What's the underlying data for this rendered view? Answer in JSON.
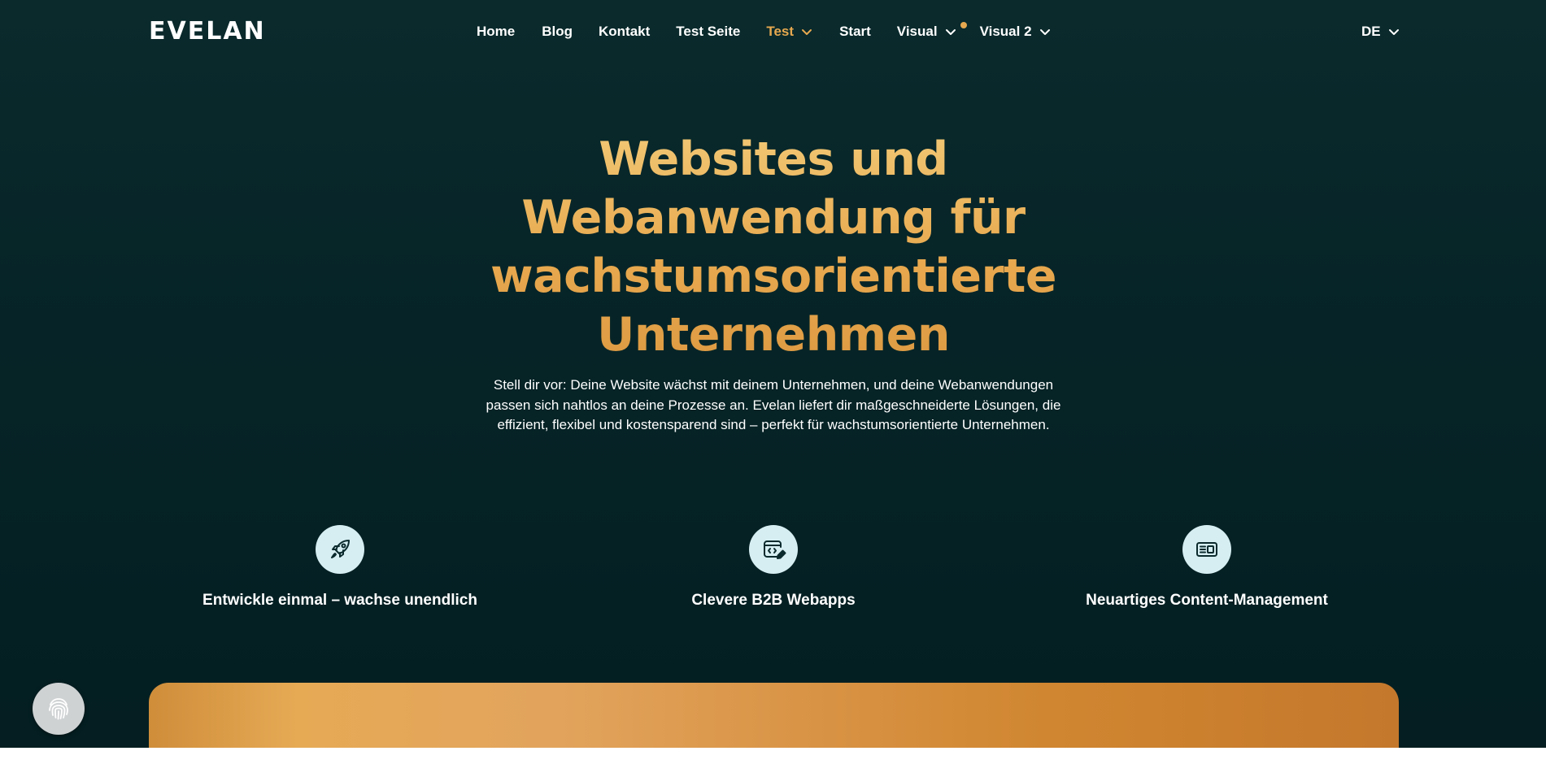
{
  "brand": {
    "logo_text": "EVELAN"
  },
  "nav": {
    "items": [
      {
        "label": "Home",
        "has_dropdown": false,
        "active": false
      },
      {
        "label": "Blog",
        "has_dropdown": false,
        "active": false
      },
      {
        "label": "Kontakt",
        "has_dropdown": false,
        "active": false
      },
      {
        "label": "Test Seite",
        "has_dropdown": false,
        "active": false
      },
      {
        "label": "Test",
        "has_dropdown": true,
        "active": true
      },
      {
        "label": "Start",
        "has_dropdown": false,
        "active": false
      },
      {
        "label": "Visual",
        "has_dropdown": true,
        "active": false,
        "notification_dot": true
      },
      {
        "label": "Visual 2",
        "has_dropdown": true,
        "active": false
      }
    ],
    "language": "DE"
  },
  "hero": {
    "headline_lines": [
      "Websites und",
      "Webanwendung für",
      "wachstumsorientierte",
      "Unternehmen"
    ],
    "lead_lines": [
      "Stell dir vor: Deine Website wächst mit deinem Unternehmen, und deine Webanwendungen",
      "passen sich nahtlos an deine Prozesse an. Evelan liefert dir maßgeschneiderte Lösungen, die",
      "effizient, flexibel und kostensparend sind – perfekt für wachstumsorientierte Unternehmen."
    ]
  },
  "features": [
    {
      "icon": "rocket-icon",
      "title": "Entwickle einmal – wachse unendlich"
    },
    {
      "icon": "code-edit-icon",
      "title": "Clevere B2B Webapps"
    },
    {
      "icon": "content-layout-icon",
      "title": "Neuartiges Content-Management"
    }
  ],
  "colors": {
    "background": "#062427",
    "accent": "#e6a84f",
    "icon_circle": "#d6eef2",
    "card_gradient_start": "#cf8d3a",
    "card_gradient_end": "#c4782c"
  },
  "fingerprint_button": {
    "icon": "fingerprint-icon"
  }
}
